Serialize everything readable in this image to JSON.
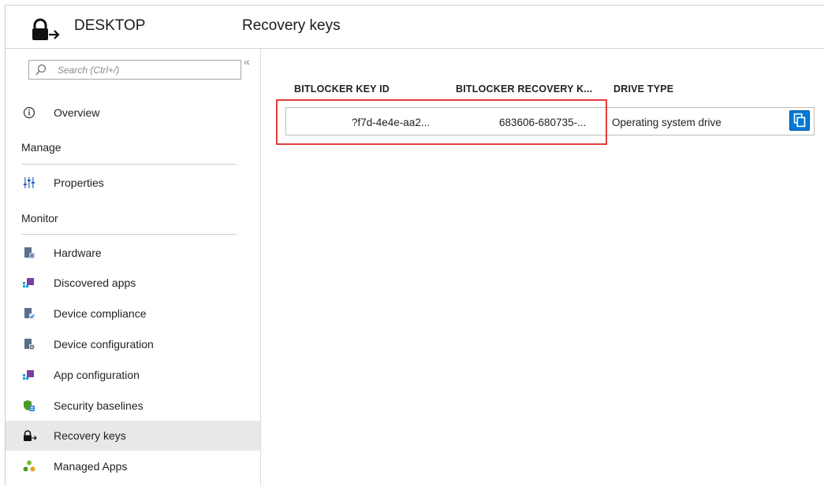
{
  "header": {
    "device_name": "DESKTOP",
    "blade_title": "Recovery keys"
  },
  "sidebar": {
    "search_placeholder": "Search (Ctrl+/)",
    "collapse_label": "«",
    "overview": "Overview",
    "sections": {
      "manage": "Manage",
      "monitor": "Monitor"
    },
    "items": [
      {
        "label": "Properties",
        "icon": "properties-icon"
      },
      {
        "label": "Hardware",
        "icon": "hardware-icon"
      },
      {
        "label": "Discovered apps",
        "icon": "discovered-apps-icon"
      },
      {
        "label": "Device compliance",
        "icon": "device-compliance-icon"
      },
      {
        "label": "Device configuration",
        "icon": "device-configuration-icon"
      },
      {
        "label": "App configuration",
        "icon": "app-configuration-icon"
      },
      {
        "label": "Security baselines",
        "icon": "security-baselines-icon"
      },
      {
        "label": "Recovery keys",
        "icon": "lock-arrow-icon",
        "selected": true
      },
      {
        "label": "Managed Apps",
        "icon": "managed-apps-icon"
      }
    ]
  },
  "table": {
    "columns": [
      "BITLOCKER KEY ID",
      "BITLOCKER RECOVERY K...",
      "DRIVE TYPE"
    ],
    "rows": [
      {
        "key_id": "?f7d-4e4e-aa2...",
        "recovery_key": "683606-680735-...",
        "drive_type": "Operating system drive"
      }
    ]
  },
  "colors": {
    "accent": "#0078d4",
    "highlight": "#e33b3b",
    "selected_bg": "#e8e8e8"
  }
}
